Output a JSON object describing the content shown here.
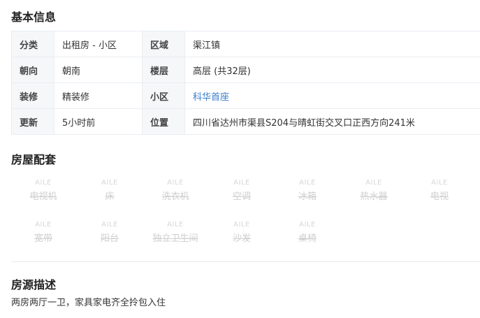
{
  "basic_info": {
    "title": "基本信息",
    "rows": [
      {
        "k1": "分类",
        "v1": "出租房 - 小区",
        "k2": "区域",
        "v2": "渠江镇"
      },
      {
        "k1": "朝向",
        "v1": "朝南",
        "k2": "楼层",
        "v2": "高层 (共32层)"
      },
      {
        "k1": "装修",
        "v1": "精装修",
        "k2": "小区",
        "v2": "科华首座"
      },
      {
        "k1": "更新",
        "v1": "5小时前",
        "k2": "位置",
        "v2": "四川省达州市渠县S204与晴虹街交叉口正西方向241米"
      }
    ]
  },
  "facilities": {
    "title": "房屋配套",
    "watermark": "AILE",
    "items": [
      {
        "label": "电视机",
        "available": false
      },
      {
        "label": "床",
        "available": false
      },
      {
        "label": "洗衣机",
        "available": false
      },
      {
        "label": "空调",
        "available": false
      },
      {
        "label": "冰箱",
        "available": false
      },
      {
        "label": "热水器",
        "available": false
      },
      {
        "label": "电视",
        "available": false
      },
      {
        "label": "宽带",
        "available": false
      },
      {
        "label": "阳台",
        "available": false
      },
      {
        "label": "独立卫生间",
        "available": false
      },
      {
        "label": "沙发",
        "available": false
      },
      {
        "label": "桌椅",
        "available": false
      }
    ]
  },
  "description": {
    "title": "房源描述",
    "text": "两房两厅一卫，家具家电齐全拎包入住"
  },
  "colors": {
    "link": "#3a7dc9",
    "key_cell_bg": "#f6f7f9",
    "border": "#e9edf2",
    "disabled_text": "#cfcfcf"
  }
}
